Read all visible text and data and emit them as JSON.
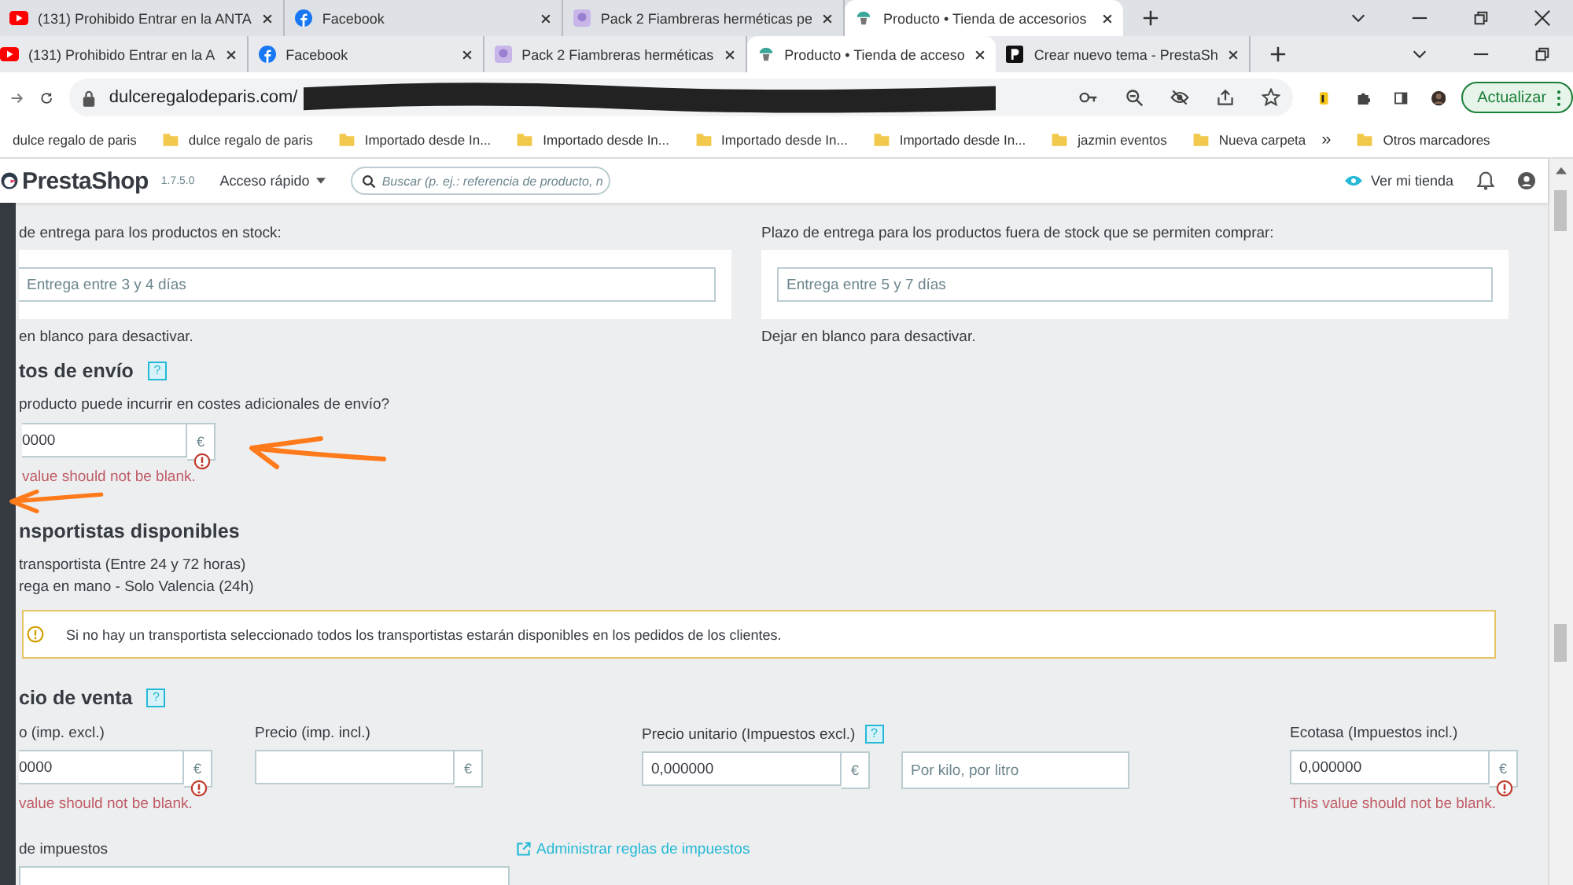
{
  "browser": {
    "outer_tabs": [
      {
        "title": "(131) Prohibido Entrar en la ANTA",
        "selected": false
      },
      {
        "title": "Facebook",
        "selected": false
      },
      {
        "title": "Pack 2 Fiambreras herméticas pe",
        "selected": false
      },
      {
        "title": "Producto • Tienda de accesorios",
        "selected": true
      }
    ],
    "inner_tabs": [
      {
        "title": "(131) Prohibido Entrar en la A",
        "selected": false
      },
      {
        "title": "Facebook",
        "selected": false
      },
      {
        "title": "Pack 2 Fiambreras herméticas",
        "selected": false
      },
      {
        "title": "Producto • Tienda de acceso",
        "selected": true
      },
      {
        "title": "Crear nuevo tema - PrestaSh",
        "selected": false
      }
    ],
    "url": "dulceregalodeparis.com/",
    "update_button": "Actualizar",
    "bookmarks": [
      {
        "label": "dulce regalo de paris",
        "kind": "text"
      },
      {
        "label": "dulce regalo de paris",
        "kind": "folder"
      },
      {
        "label": "Importado desde In...",
        "kind": "folder"
      },
      {
        "label": "Importado desde In...",
        "kind": "folder"
      },
      {
        "label": "Importado desde In...",
        "kind": "folder"
      },
      {
        "label": "Importado desde In...",
        "kind": "folder"
      },
      {
        "label": "jazmin eventos",
        "kind": "folder"
      },
      {
        "label": "Nueva carpeta",
        "kind": "folder"
      }
    ],
    "bookmarks_more": "»",
    "other_bookmarks": "Otros marcadores"
  },
  "admin_header": {
    "brand": "PrestaShop",
    "version": "1.7.5.0",
    "quick_access": "Acceso rápido",
    "search_placeholder": "Buscar (p. ej.: referencia de producto, n",
    "view_store": "Ver mi tienda"
  },
  "delivery": [
    {
      "label": "de entrega para los productos en stock:",
      "placeholder": "Entrega entre 3 y 4 días",
      "hint": "en blanco para desactivar."
    },
    {
      "label": "Plazo de entrega para los productos fuera de stock que se permiten comprar:",
      "placeholder": "Entrega entre 5 y 7 días",
      "hint": "Dejar en blanco para desactivar."
    }
  ],
  "shipping_costs": {
    "heading": "tos de envío",
    "help": "?",
    "question": "producto puede incurrir en costes adicionales de envío?",
    "value": "0000",
    "currency": "€",
    "error": "value should not be blank."
  },
  "carriers": {
    "heading": "nsportistas disponibles",
    "items": [
      "transportista (Entre 24 y 72 horas)",
      "rega en mano - Solo Valencia (24h)"
    ],
    "notice": "Si no hay un transportista seleccionado todos los transportistas estarán disponibles en los pedidos de los clientes."
  },
  "pricing": {
    "heading": "cio de venta",
    "help": "?",
    "fields": [
      {
        "label": "o (imp. excl.)",
        "value": "0000",
        "currency": "€",
        "error": "value should not be blank."
      },
      {
        "label": "Precio (imp. incl.)",
        "currency": "€"
      },
      {
        "label": "Precio unitario (Impuestos excl.)",
        "help": "?",
        "value": "0,000000",
        "currency": "€",
        "unit_placeholder": "Por kilo, por litro"
      },
      {
        "label": "Ecotasa (Impuestos incl.)",
        "value": "0,000000",
        "currency": "€",
        "error": "This value should not be blank."
      }
    ]
  },
  "tax": {
    "label": "de impuestos",
    "link": "Administrar reglas de impuestos"
  }
}
